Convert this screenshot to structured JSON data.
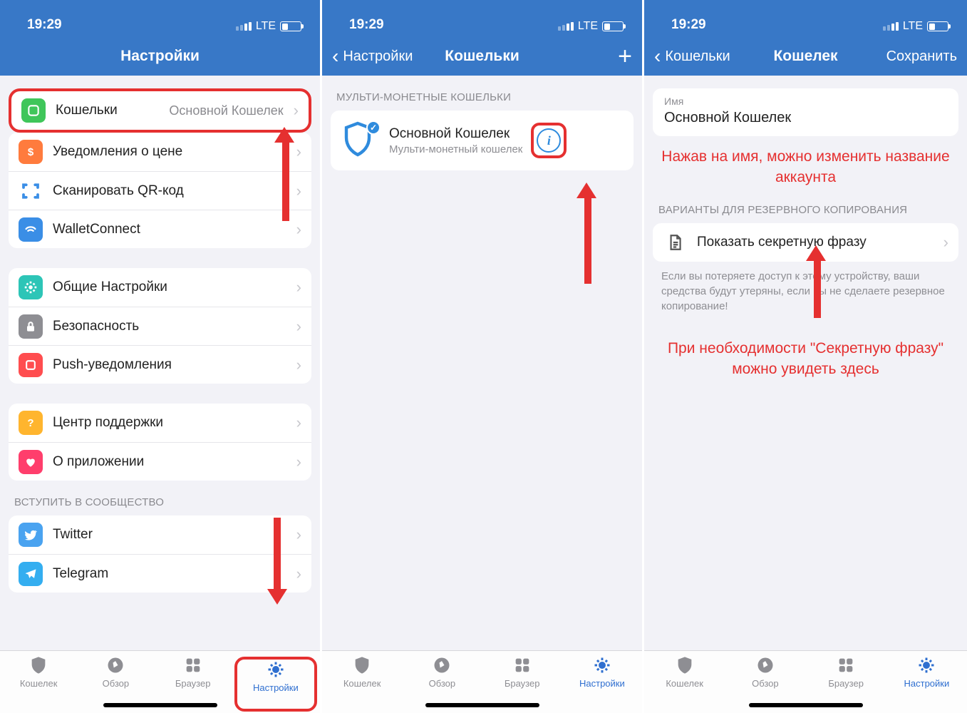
{
  "status": {
    "time": "19:29",
    "carrier": "LTE"
  },
  "tabs": {
    "wallet": "Кошелек",
    "browse": "Обзор",
    "browser": "Браузер",
    "settings": "Настройки"
  },
  "screen1": {
    "title": "Настройки",
    "wallets_row": {
      "label": "Кошельки",
      "value": "Основной Кошелек"
    },
    "rows_a": [
      {
        "label": "Уведомления о цене"
      },
      {
        "label": "Сканировать QR-код"
      },
      {
        "label": "WalletConnect"
      }
    ],
    "rows_b": [
      {
        "label": "Общие Настройки"
      },
      {
        "label": "Безопасность"
      },
      {
        "label": "Push-уведомления"
      }
    ],
    "rows_c": [
      {
        "label": "Центр поддержки"
      },
      {
        "label": "О приложении"
      }
    ],
    "community_header": "ВСТУПИТЬ В СООБЩЕСТВО",
    "rows_d": [
      {
        "label": "Twitter"
      },
      {
        "label": "Telegram"
      }
    ]
  },
  "screen2": {
    "back": "Настройки",
    "title": "Кошельки",
    "section": "МУЛЬТИ-МОНЕТНЫЕ КОШЕЛЬКИ",
    "wallet": {
      "title": "Основной Кошелек",
      "subtitle": "Мульти-монетный кошелек"
    }
  },
  "screen3": {
    "back": "Кошельки",
    "title": "Кошелек",
    "save": "Сохранить",
    "name_label": "Имя",
    "name_value": "Основной Кошелек",
    "annot1": "Нажав на имя, можно изменить название  аккаунта",
    "backup_header": "ВАРИАНТЫ ДЛЯ РЕЗЕРВНОГО КОПИРОВАНИЯ",
    "backup_row": "Показать секретную фразу",
    "footnote": "Если вы потеряете доступ к этому устройству, ваши средства будут утеряны, если вы не сделаете резервное копирование!",
    "annot2": "При необходимости \"Секретную фразу\" можно увидеть здесь"
  }
}
